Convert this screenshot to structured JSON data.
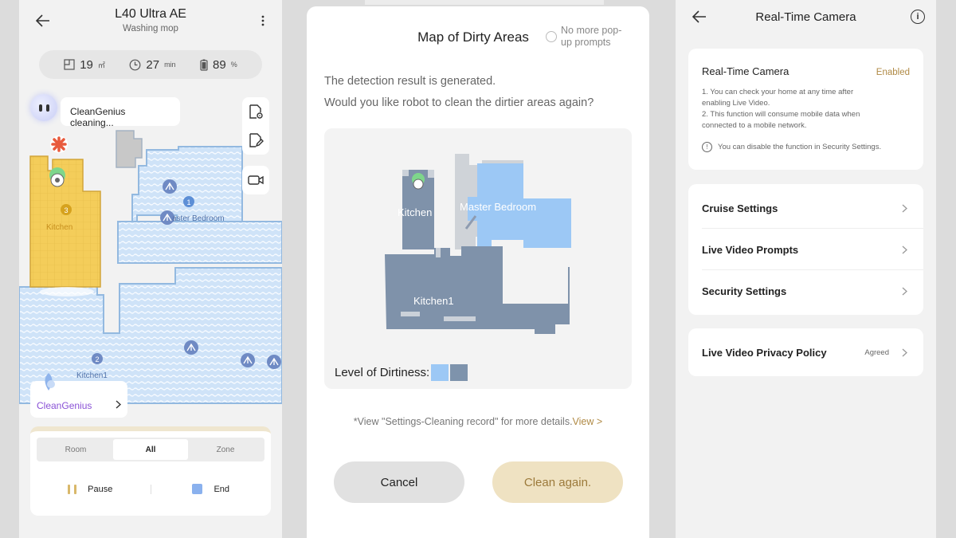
{
  "panel1": {
    "title": "L40 Ultra AE",
    "subtitle": "Washing mop",
    "stats": [
      {
        "icon": "area-icon",
        "value": "19",
        "unit": "㎡"
      },
      {
        "icon": "clock-icon",
        "value": "27",
        "unit": "min"
      },
      {
        "icon": "battery-icon",
        "value": "89",
        "unit": "%"
      }
    ],
    "bubble": "CleanGenius cleaning...",
    "map": {
      "kitchen_label": "Kitchen",
      "master_bedroom_label": "aster Bedroom",
      "kitchen1_label": "Kitchen1",
      "room_numbers": [
        "1",
        "2",
        "3"
      ]
    },
    "cleangenius_label": "CleanGenius",
    "segments": [
      "Room",
      "All",
      "Zone"
    ],
    "active_segment": "All",
    "pause_label": "Pause",
    "end_label": "End"
  },
  "panel2": {
    "title": "Map of Dirty Areas",
    "no_more_prompts": "No more pop-up prompts",
    "message_line1": "The detection result is generated.",
    "message_line2": "Would you like robot to clean the dirtier areas again?",
    "map": {
      "kitchen_label": "Kitchen",
      "master_bedroom_label": "Master Bedroom",
      "kitchen1_label": "Kitchen1"
    },
    "dirtiness_label": "Level of Dirtiness:",
    "dirtiness_colors": [
      "#9cc8f5",
      "#7e93ac"
    ],
    "note_text": "*View \"Settings-Cleaning record\" for more details.",
    "note_link": "View >",
    "cancel_label": "Cancel",
    "clean_again_label": "Clean again."
  },
  "panel3": {
    "title": "Real-Time Camera",
    "card_title": "Real-Time Camera",
    "card_status": "Enabled",
    "desc_line1": "1. You can check your home at any time after enabling Live Video.",
    "desc_line2": "2. This function will consume mobile data when connected to a mobile network.",
    "warning": "You can disable the function in Security Settings.",
    "settings": [
      "Cruise Settings",
      "Live Video Prompts",
      "Security Settings"
    ],
    "privacy_label": "Live Video Privacy Policy",
    "privacy_value": "Agreed"
  },
  "colors": {
    "kitchen_fill": "#f4cd5a",
    "room_blue": "#a6cdf5",
    "path_blue": "#dcebfa",
    "dirty_gray": "#7f92aa",
    "accent_gold": "#b08a45"
  }
}
